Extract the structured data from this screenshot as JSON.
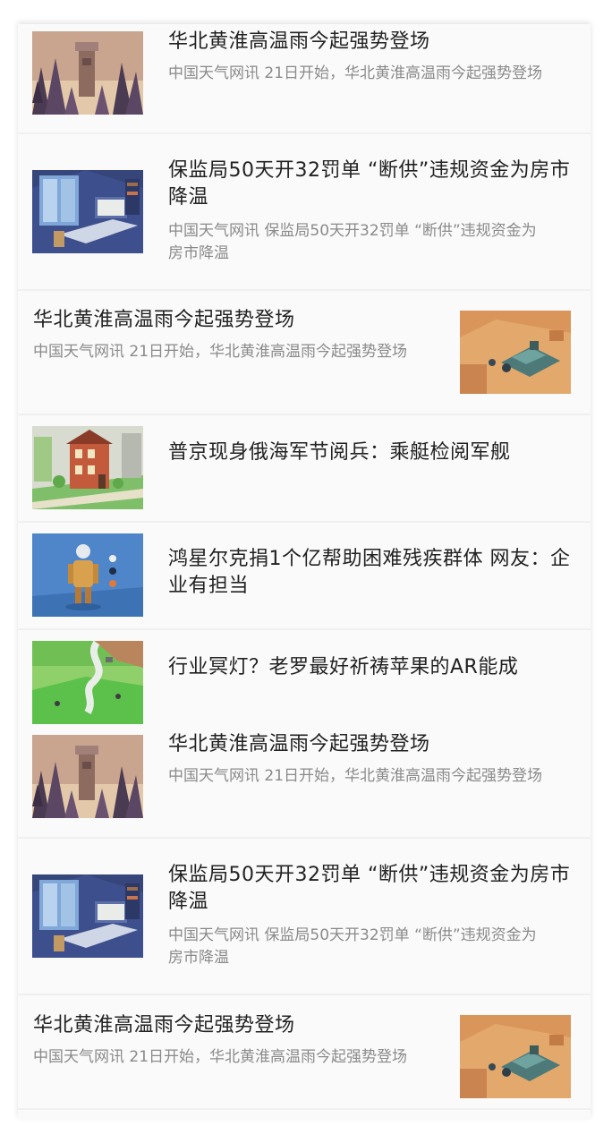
{
  "feed": {
    "items": [
      {
        "title": "华北黄淮高温雨今起强势登场",
        "summary": "中国天气网讯 21日开始，华北黄淮高温雨今起强势登场",
        "thumbnail": "forest-tower-image"
      },
      {
        "title": "保监局50天开32罚单 “断供”违规资金为房市降温",
        "summary": "中国天气网讯 保监局50天开32罚单 “断供”违规资金为房市降温",
        "thumbnail": "isometric-room-image"
      },
      {
        "title": "华北黄淮高温雨今起强势登场",
        "summary": "中国天气网讯 21日开始，华北黄淮高温雨今起强势登场",
        "thumbnail": "desert-tank-image"
      },
      {
        "title": "普京现身俄海军节阅兵：乘艇检阅军舰",
        "summary": "",
        "thumbnail": "city-house-image"
      },
      {
        "title": "鸿星尔克捐1个亿帮助困难残疾群体 网友：企业有担当",
        "summary": "",
        "thumbnail": "robot-figure-image"
      },
      {
        "title": "行业冥灯？老罗最好祈祷苹果的AR能成",
        "summary": "",
        "thumbnail": "green-hills-tornado-image"
      },
      {
        "title": "华北黄淮高温雨今起强势登场",
        "summary": "中国天气网讯 21日开始，华北黄淮高温雨今起强势登场",
        "thumbnail": "forest-tower-image"
      },
      {
        "title": "保监局50天开32罚单 “断供”违规资金为房市降温",
        "summary": "中国天气网讯 保监局50天开32罚单 “断供”违规资金为房市降温",
        "thumbnail": "isometric-room-image"
      },
      {
        "title": "华北黄淮高温雨今起强势登场",
        "summary": "中国天气网讯 21日开始，华北黄淮高温雨今起强势登场",
        "thumbnail": "desert-tank-image"
      }
    ]
  }
}
